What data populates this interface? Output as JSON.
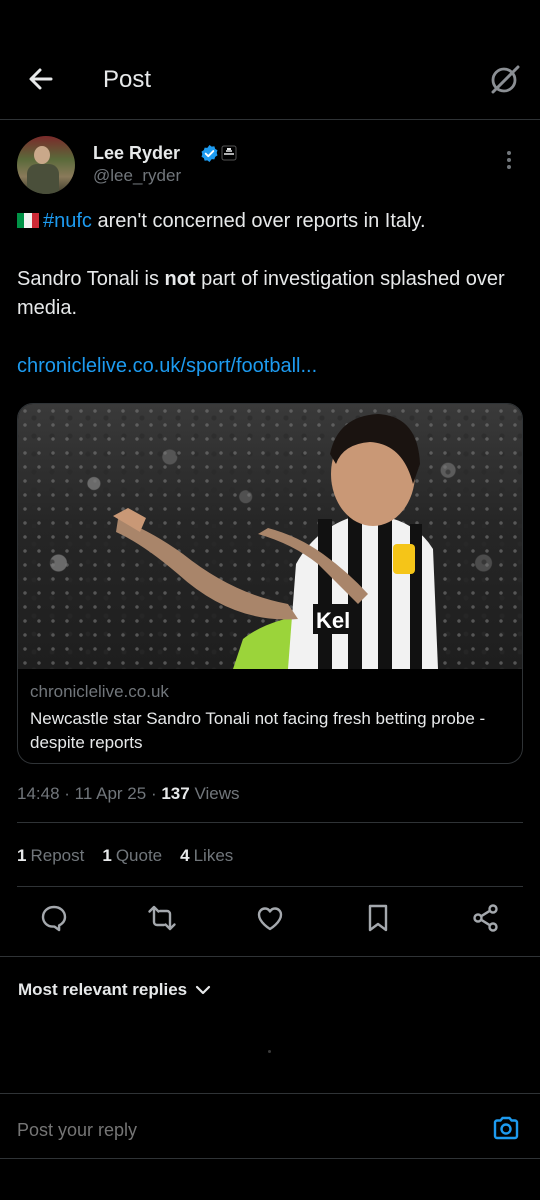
{
  "header": {
    "title": "Post"
  },
  "author": {
    "name": "Lee Ryder",
    "handle": "@lee_ryder"
  },
  "post": {
    "hashtag": "#nufc",
    "line1_rest": " aren't concerned over reports in Italy.",
    "line2_before": "Sandro Tonali is ",
    "line2_bold": "not",
    "line2_after": " part of investigation splashed over media.",
    "link": "chroniclelive.co.uk/sport/football..."
  },
  "card": {
    "domain": "chroniclelive.co.uk",
    "title": "Newcastle star Sandro Tonali not facing fresh betting probe - despite reports"
  },
  "meta": {
    "time": "14:48",
    "date": "11 Apr 25",
    "views_count": "137",
    "views_label": "Views"
  },
  "stats": {
    "reposts_count": "1",
    "reposts_label": "Repost",
    "quotes_count": "1",
    "quotes_label": "Quote",
    "likes_count": "4",
    "likes_label": "Likes"
  },
  "replies": {
    "sort_label": "Most relevant replies"
  },
  "reply_bar": {
    "placeholder": "Post your reply"
  },
  "colors": {
    "accent": "#1d9bf0",
    "background": "#000000",
    "muted": "#71767b",
    "text": "#e7e9ea"
  },
  "icons": [
    "back-arrow-icon",
    "grok-icon",
    "verified-badge-icon",
    "affiliate-badge-icon",
    "more-options-icon",
    "reply-icon",
    "repost-icon",
    "like-icon",
    "bookmark-icon",
    "share-icon",
    "chevron-down-icon",
    "camera-icon"
  ]
}
